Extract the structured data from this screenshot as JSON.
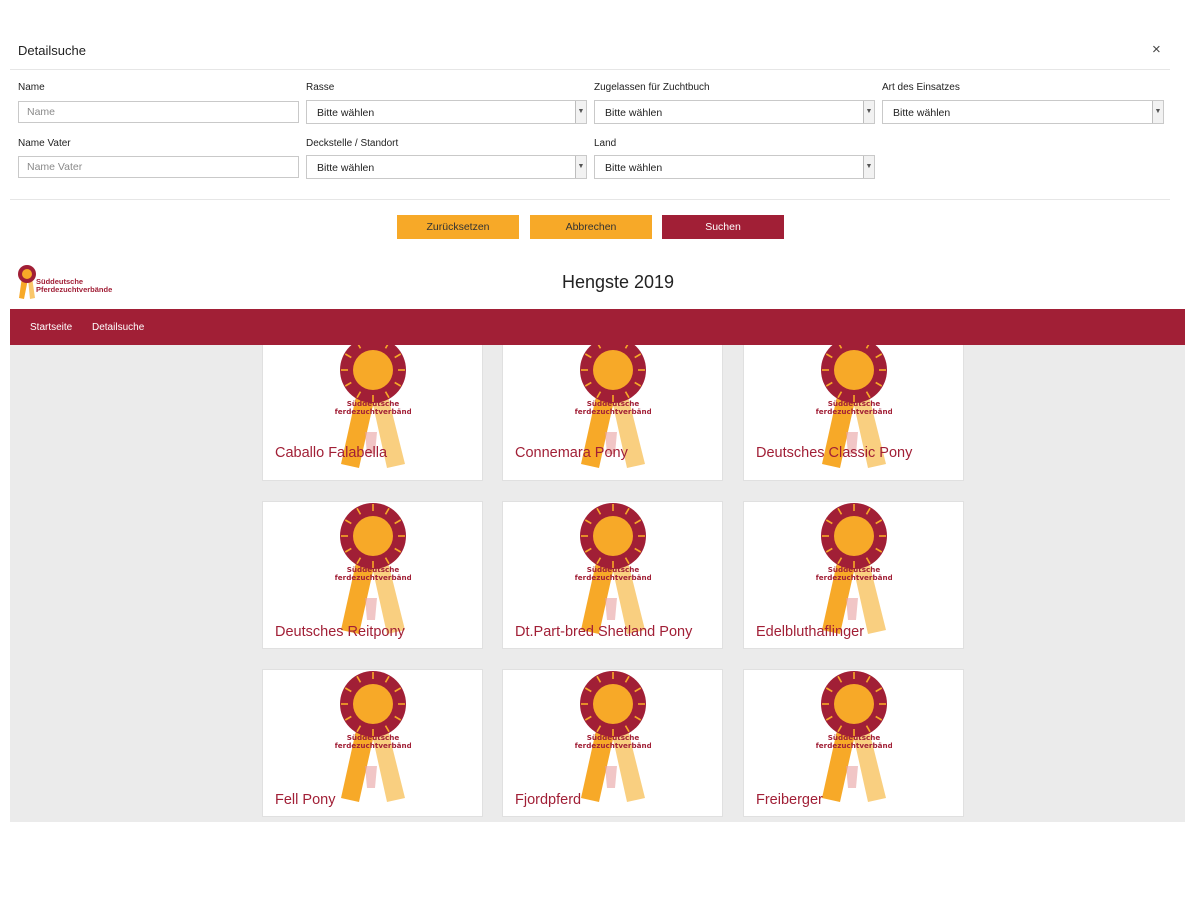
{
  "search_panel": {
    "title": "Detailsuche",
    "close_symbol": "×",
    "fields": {
      "name": {
        "label": "Name",
        "placeholder": "Name"
      },
      "rasse": {
        "label": "Rasse",
        "value": "Bitte wählen"
      },
      "zuchtbuch": {
        "label": "Zugelassen für Zuchtbuch",
        "value": "Bitte wählen"
      },
      "einsatz": {
        "label": "Art des Einsatzes",
        "value": "Bitte wählen"
      },
      "name_vater": {
        "label": "Name Vater",
        "placeholder": "Name Vater"
      },
      "deckstelle": {
        "label": "Deckstelle / Standort",
        "value": "Bitte wählen"
      },
      "land": {
        "label": "Land",
        "value": "Bitte wählen"
      }
    },
    "buttons": {
      "reset": "Zurücksetzen",
      "cancel": "Abbrechen",
      "search": "Suchen"
    }
  },
  "header": {
    "logo_line1": "Süddeutsche",
    "logo_line2": "Pferdezuchtverbände",
    "title": "Hengste 2019"
  },
  "nav": {
    "items": [
      "Startseite",
      "Detailsuche"
    ]
  },
  "cards": [
    {
      "label": "Caballo Falabella",
      "badge_line1": "Süddeutsche",
      "badge_line2": "Pferdezuchtverbände"
    },
    {
      "label": "Connemara Pony",
      "badge_line1": "Süddeutsche",
      "badge_line2": "Pferdezuchtverbände"
    },
    {
      "label": "Deutsches Classic Pony",
      "badge_line1": "Süddeutsche",
      "badge_line2": "Pferdezuchtverbände"
    },
    {
      "label": "Deutsches Reitpony",
      "badge_line1": "Süddeutsche",
      "badge_line2": "Pferdezuchtverbände"
    },
    {
      "label": "Dt.Part-bred Shetland Pony",
      "badge_line1": "Süddeutsche",
      "badge_line2": "Pferdezuchtverbände"
    },
    {
      "label": "Edelbluthaflinger",
      "badge_line1": "Süddeutsche",
      "badge_line2": "Pferdezuchtverbände"
    },
    {
      "label": "Fell Pony",
      "badge_line1": "Süddeutsche",
      "badge_line2": "Pferdezuchtverbände"
    },
    {
      "label": "Fjordpferd",
      "badge_line1": "Süddeutsche",
      "badge_line2": "Pferdezuchtverbände"
    },
    {
      "label": "Freiberger",
      "badge_line1": "Süddeutsche",
      "badge_line2": "Pferdezuchtverbände"
    }
  ],
  "colors": {
    "brand_red": "#a11f36",
    "brand_yellow": "#f7a928",
    "gallery_bg": "#ebebeb"
  },
  "icons": {
    "logo": "rosette-icon",
    "close": "close-icon",
    "dropdown": "chevron-down-icon"
  }
}
